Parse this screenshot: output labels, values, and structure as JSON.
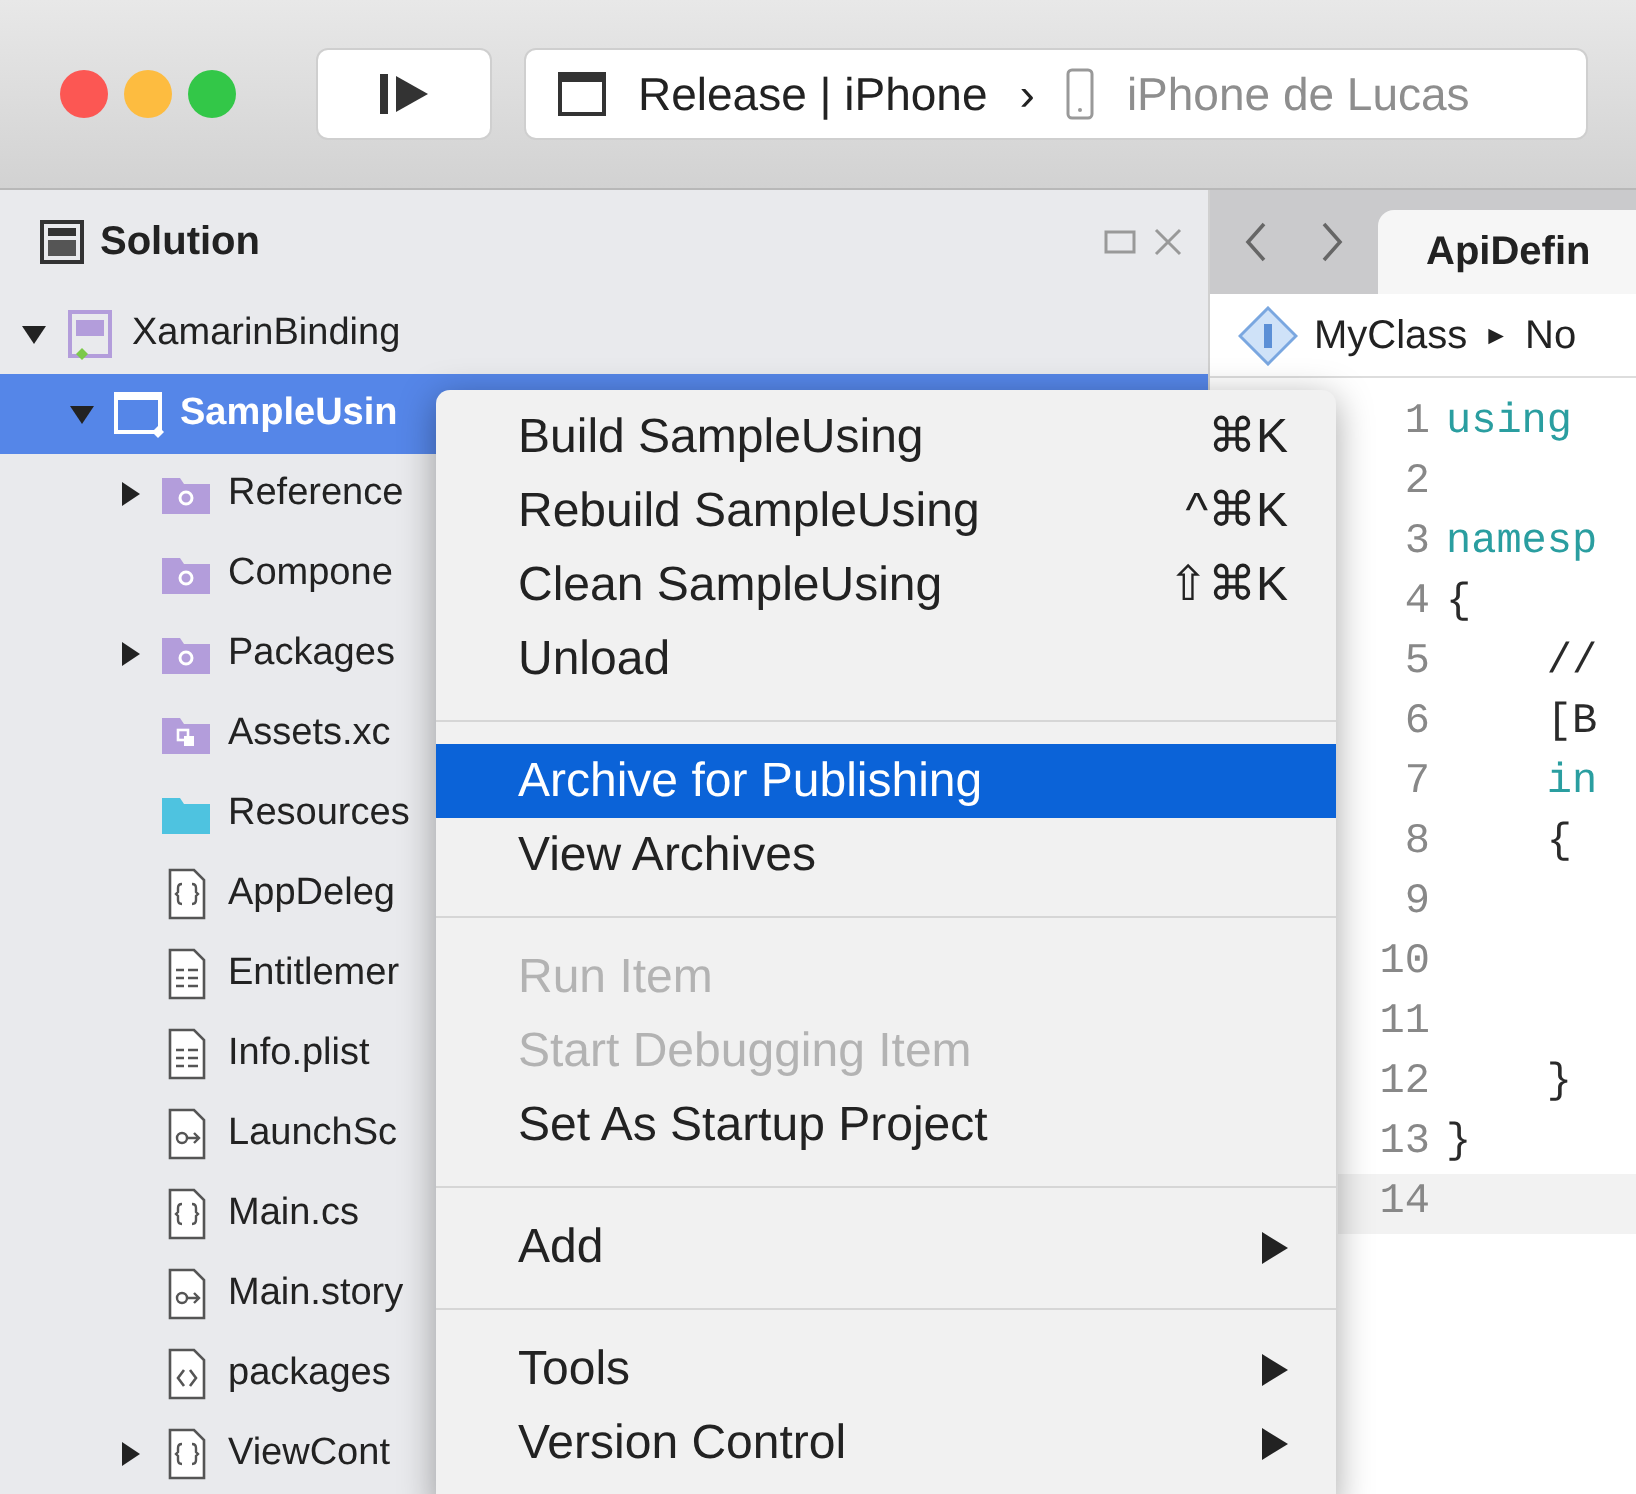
{
  "toolbar": {
    "scheme": "Release | iPhone",
    "separator": "›",
    "device": "iPhone de Lucas"
  },
  "solution_pad": {
    "title": "Solution",
    "tree": [
      {
        "label": "XamarinBinding",
        "kind": "solution",
        "expanded": true,
        "selected": false,
        "children": [
          {
            "label": "SampleUsin",
            "kind": "project",
            "expanded": true,
            "selected": true,
            "children": [
              {
                "label": "Reference",
                "kind": "folder-ref",
                "expanded": false,
                "selected": false
              },
              {
                "label": "Compone",
                "kind": "folder-ref",
                "selected": false
              },
              {
                "label": "Packages",
                "kind": "folder-ref",
                "expanded": false,
                "selected": false
              },
              {
                "label": "Assets.xc",
                "kind": "folder-assets",
                "selected": false
              },
              {
                "label": "Resources",
                "kind": "folder",
                "selected": false
              },
              {
                "label": "AppDeleg",
                "kind": "code",
                "selected": false
              },
              {
                "label": "Entitlemer",
                "kind": "plist",
                "selected": false
              },
              {
                "label": "Info.plist",
                "kind": "plist",
                "selected": false
              },
              {
                "label": "LaunchSc",
                "kind": "storyboard",
                "selected": false
              },
              {
                "label": "Main.cs",
                "kind": "code",
                "selected": false
              },
              {
                "label": "Main.story",
                "kind": "storyboard",
                "selected": false
              },
              {
                "label": "packages",
                "kind": "xml",
                "selected": false
              },
              {
                "label": "ViewCont",
                "kind": "code",
                "expanded": false,
                "selected": false
              }
            ]
          }
        ]
      }
    ]
  },
  "context_menu": [
    {
      "kind": "item",
      "label": "Build SampleUsing",
      "shortcut": "⌘K",
      "disabled": false,
      "selected": false,
      "submenu": false
    },
    {
      "kind": "item",
      "label": "Rebuild SampleUsing",
      "shortcut": "^⌘K",
      "disabled": false,
      "selected": false,
      "submenu": false
    },
    {
      "kind": "item",
      "label": "Clean SampleUsing",
      "shortcut": "⇧⌘K",
      "disabled": false,
      "selected": false,
      "submenu": false
    },
    {
      "kind": "item",
      "label": "Unload",
      "disabled": false,
      "selected": false,
      "submenu": false
    },
    {
      "kind": "separator"
    },
    {
      "kind": "item",
      "label": "Archive for Publishing",
      "disabled": false,
      "selected": true,
      "submenu": false
    },
    {
      "kind": "item",
      "label": "View Archives",
      "disabled": false,
      "selected": false,
      "submenu": false
    },
    {
      "kind": "separator"
    },
    {
      "kind": "item",
      "label": "Run Item",
      "disabled": true,
      "selected": false,
      "submenu": false
    },
    {
      "kind": "item",
      "label": "Start Debugging Item",
      "disabled": true,
      "selected": false,
      "submenu": false
    },
    {
      "kind": "item",
      "label": "Set As Startup Project",
      "disabled": false,
      "selected": false,
      "submenu": false
    },
    {
      "kind": "separator"
    },
    {
      "kind": "item",
      "label": "Add",
      "disabled": false,
      "selected": false,
      "submenu": true
    },
    {
      "kind": "separator"
    },
    {
      "kind": "item",
      "label": "Tools",
      "disabled": false,
      "selected": false,
      "submenu": true
    },
    {
      "kind": "item",
      "label": "Version Control",
      "disabled": false,
      "selected": false,
      "submenu": true
    }
  ],
  "editor": {
    "tab": "ApiDefin",
    "breadcrumb": [
      "MyClass",
      "►",
      "No"
    ],
    "lines": [
      {
        "number": "1",
        "code": "using"
      },
      {
        "number": "2"
      },
      {
        "number": "3",
        "code": "namesp"
      },
      {
        "number": "4",
        "code": "{"
      },
      {
        "number": "5",
        "code": "    //"
      },
      {
        "number": "6",
        "code": "    [B"
      },
      {
        "number": "7",
        "code": "    in"
      },
      {
        "number": "8",
        "code": "    {"
      },
      {
        "number": "9"
      },
      {
        "number": "10"
      },
      {
        "number": "11"
      },
      {
        "number": "12",
        "code": "    }"
      },
      {
        "number": "13",
        "code": "}"
      },
      {
        "number": "14",
        "current": true
      }
    ]
  }
}
